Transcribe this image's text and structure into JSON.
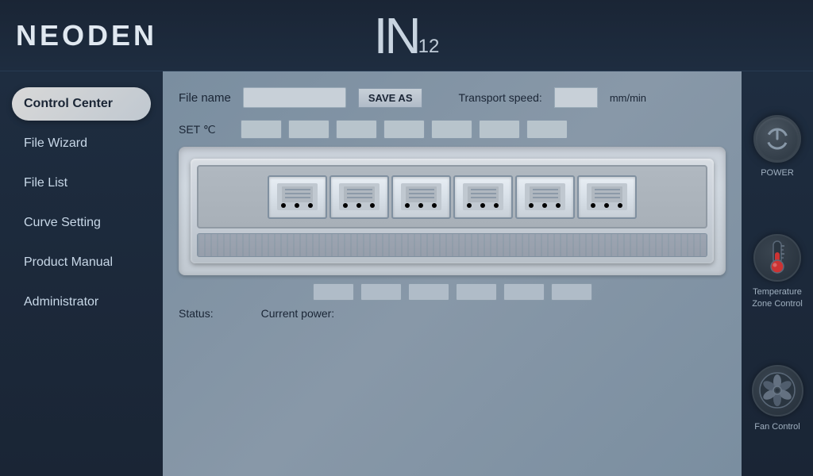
{
  "header": {
    "brand": "NEODEN",
    "logo_in": "IN",
    "logo_number": "12"
  },
  "sidebar": {
    "items": [
      {
        "id": "control-center",
        "label": "Control Center",
        "active": true
      },
      {
        "id": "file-wizard",
        "label": "File Wizard",
        "active": false
      },
      {
        "id": "file-list",
        "label": "File List",
        "active": false
      },
      {
        "id": "curve-setting",
        "label": "Curve Setting",
        "active": false
      },
      {
        "id": "product-manual",
        "label": "Product Manual",
        "active": false
      },
      {
        "id": "administrator",
        "label": "Administrator",
        "active": false
      }
    ]
  },
  "main": {
    "file_name_label": "File name",
    "file_name_value": "",
    "save_as_label": "SAVE AS",
    "transport_speed_label": "Transport speed:",
    "transport_speed_value": "",
    "transport_unit": "mm/min",
    "set_temp_label": "SET ℃",
    "temp_values": [
      "",
      "",
      "",
      "",
      "",
      "",
      ""
    ],
    "bottom_temp_values": [
      "",
      "",
      "",
      "",
      "",
      ""
    ],
    "status_label": "Status:",
    "status_value": "",
    "current_power_label": "Current power:",
    "current_power_value": ""
  },
  "right_panel": {
    "power_label": "POWER",
    "temp_zone_label": "Temperature\nZone Control",
    "fan_control_label": "Fan Control"
  }
}
